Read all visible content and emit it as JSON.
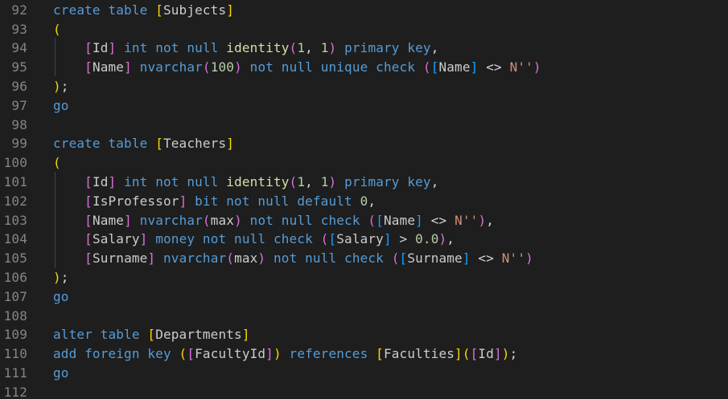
{
  "editor": {
    "colors": {
      "background": "#1e1e1e",
      "line_number": "#858585",
      "keyword": "#569cd6",
      "bracket_gold": "#ffd700",
      "identifier": "#cccccc",
      "function": "#dcdcaa",
      "bracket_purple": "#da70d6",
      "bracket_blue": "#179fff",
      "number": "#b5cea8",
      "string": "#ce9178"
    },
    "lines": [
      {
        "number": "92",
        "tokens": [
          {
            "text": "create table ",
            "kind": "kw"
          },
          {
            "text": "[",
            "kind": "br"
          },
          {
            "text": "Subjects",
            "kind": "id"
          },
          {
            "text": "]",
            "kind": "br"
          }
        ]
      },
      {
        "number": "93",
        "tokens": [
          {
            "text": "(",
            "kind": "br"
          }
        ]
      },
      {
        "number": "94",
        "tokens": [
          {
            "text": "    ",
            "kind": "op"
          },
          {
            "text": "[",
            "kind": "pp"
          },
          {
            "text": "Id",
            "kind": "id"
          },
          {
            "text": "]",
            "kind": "pp"
          },
          {
            "text": " int not null ",
            "kind": "kw"
          },
          {
            "text": "identity",
            "kind": "fn"
          },
          {
            "text": "(",
            "kind": "pp"
          },
          {
            "text": "1",
            "kind": "num"
          },
          {
            "text": ", ",
            "kind": "op"
          },
          {
            "text": "1",
            "kind": "num"
          },
          {
            "text": ")",
            "kind": "pp"
          },
          {
            "text": " primary key",
            "kind": "kw"
          },
          {
            "text": ",",
            "kind": "op"
          }
        ]
      },
      {
        "number": "95",
        "tokens": [
          {
            "text": "    ",
            "kind": "op"
          },
          {
            "text": "[",
            "kind": "pp"
          },
          {
            "text": "Name",
            "kind": "id"
          },
          {
            "text": "]",
            "kind": "pp"
          },
          {
            "text": " nvarchar",
            "kind": "kw"
          },
          {
            "text": "(",
            "kind": "pp"
          },
          {
            "text": "100",
            "kind": "num"
          },
          {
            "text": ")",
            "kind": "pp"
          },
          {
            "text": " not null unique check ",
            "kind": "kw"
          },
          {
            "text": "(",
            "kind": "pp"
          },
          {
            "text": "[",
            "kind": "pb"
          },
          {
            "text": "Name",
            "kind": "id"
          },
          {
            "text": "]",
            "kind": "pb"
          },
          {
            "text": " <> ",
            "kind": "op"
          },
          {
            "text": "N''",
            "kind": "str"
          },
          {
            "text": ")",
            "kind": "pp"
          }
        ]
      },
      {
        "number": "96",
        "tokens": [
          {
            "text": ")",
            "kind": "br"
          },
          {
            "text": ";",
            "kind": "op"
          }
        ]
      },
      {
        "number": "97",
        "tokens": [
          {
            "text": "go",
            "kind": "kw"
          }
        ]
      },
      {
        "number": "98",
        "tokens": []
      },
      {
        "number": "99",
        "tokens": [
          {
            "text": "create table ",
            "kind": "kw"
          },
          {
            "text": "[",
            "kind": "br"
          },
          {
            "text": "Teachers",
            "kind": "id"
          },
          {
            "text": "]",
            "kind": "br"
          }
        ]
      },
      {
        "number": "100",
        "tokens": [
          {
            "text": "(",
            "kind": "br"
          }
        ]
      },
      {
        "number": "101",
        "tokens": [
          {
            "text": "    ",
            "kind": "op"
          },
          {
            "text": "[",
            "kind": "pp"
          },
          {
            "text": "Id",
            "kind": "id"
          },
          {
            "text": "]",
            "kind": "pp"
          },
          {
            "text": " int not null ",
            "kind": "kw"
          },
          {
            "text": "identity",
            "kind": "fn"
          },
          {
            "text": "(",
            "kind": "pp"
          },
          {
            "text": "1",
            "kind": "num"
          },
          {
            "text": ", ",
            "kind": "op"
          },
          {
            "text": "1",
            "kind": "num"
          },
          {
            "text": ")",
            "kind": "pp"
          },
          {
            "text": " primary key",
            "kind": "kw"
          },
          {
            "text": ",",
            "kind": "op"
          }
        ]
      },
      {
        "number": "102",
        "tokens": [
          {
            "text": "    ",
            "kind": "op"
          },
          {
            "text": "[",
            "kind": "pp"
          },
          {
            "text": "IsProfessor",
            "kind": "id"
          },
          {
            "text": "]",
            "kind": "pp"
          },
          {
            "text": " bit not null default ",
            "kind": "kw"
          },
          {
            "text": "0",
            "kind": "num"
          },
          {
            "text": ",",
            "kind": "op"
          }
        ]
      },
      {
        "number": "103",
        "tokens": [
          {
            "text": "    ",
            "kind": "op"
          },
          {
            "text": "[",
            "kind": "pp"
          },
          {
            "text": "Name",
            "kind": "id"
          },
          {
            "text": "]",
            "kind": "pp"
          },
          {
            "text": " nvarchar",
            "kind": "kw"
          },
          {
            "text": "(",
            "kind": "pp"
          },
          {
            "text": "max",
            "kind": "id"
          },
          {
            "text": ")",
            "kind": "pp"
          },
          {
            "text": " not null check ",
            "kind": "kw"
          },
          {
            "text": "(",
            "kind": "pp"
          },
          {
            "text": "[",
            "kind": "pb"
          },
          {
            "text": "Name",
            "kind": "id"
          },
          {
            "text": "]",
            "kind": "pb"
          },
          {
            "text": " <> ",
            "kind": "op"
          },
          {
            "text": "N''",
            "kind": "str"
          },
          {
            "text": ")",
            "kind": "pp"
          },
          {
            "text": ",",
            "kind": "op"
          }
        ]
      },
      {
        "number": "104",
        "tokens": [
          {
            "text": "    ",
            "kind": "op"
          },
          {
            "text": "[",
            "kind": "pp"
          },
          {
            "text": "Salary",
            "kind": "id"
          },
          {
            "text": "]",
            "kind": "pp"
          },
          {
            "text": " money not null check ",
            "kind": "kw"
          },
          {
            "text": "(",
            "kind": "pp"
          },
          {
            "text": "[",
            "kind": "pb"
          },
          {
            "text": "Salary",
            "kind": "id"
          },
          {
            "text": "]",
            "kind": "pb"
          },
          {
            "text": " > ",
            "kind": "op"
          },
          {
            "text": "0.0",
            "kind": "num"
          },
          {
            "text": ")",
            "kind": "pp"
          },
          {
            "text": ",",
            "kind": "op"
          }
        ]
      },
      {
        "number": "105",
        "tokens": [
          {
            "text": "    ",
            "kind": "op"
          },
          {
            "text": "[",
            "kind": "pp"
          },
          {
            "text": "Surname",
            "kind": "id"
          },
          {
            "text": "]",
            "kind": "pp"
          },
          {
            "text": " nvarchar",
            "kind": "kw"
          },
          {
            "text": "(",
            "kind": "pp"
          },
          {
            "text": "max",
            "kind": "id"
          },
          {
            "text": ")",
            "kind": "pp"
          },
          {
            "text": " not null check ",
            "kind": "kw"
          },
          {
            "text": "(",
            "kind": "pp"
          },
          {
            "text": "[",
            "kind": "pb"
          },
          {
            "text": "Surname",
            "kind": "id"
          },
          {
            "text": "]",
            "kind": "pb"
          },
          {
            "text": " <> ",
            "kind": "op"
          },
          {
            "text": "N''",
            "kind": "str"
          },
          {
            "text": ")",
            "kind": "pp"
          }
        ]
      },
      {
        "number": "106",
        "tokens": [
          {
            "text": ")",
            "kind": "br"
          },
          {
            "text": ";",
            "kind": "op"
          }
        ]
      },
      {
        "number": "107",
        "tokens": [
          {
            "text": "go",
            "kind": "kw"
          }
        ]
      },
      {
        "number": "108",
        "tokens": []
      },
      {
        "number": "109",
        "tokens": [
          {
            "text": "alter table ",
            "kind": "kw"
          },
          {
            "text": "[",
            "kind": "br"
          },
          {
            "text": "Departments",
            "kind": "id"
          },
          {
            "text": "]",
            "kind": "br"
          }
        ]
      },
      {
        "number": "110",
        "tokens": [
          {
            "text": "add foreign key ",
            "kind": "kw"
          },
          {
            "text": "(",
            "kind": "br"
          },
          {
            "text": "[",
            "kind": "pp"
          },
          {
            "text": "FacultyId",
            "kind": "id"
          },
          {
            "text": "]",
            "kind": "pp"
          },
          {
            "text": ")",
            "kind": "br"
          },
          {
            "text": " references ",
            "kind": "kw"
          },
          {
            "text": "[",
            "kind": "br"
          },
          {
            "text": "Faculties",
            "kind": "id"
          },
          {
            "text": "]",
            "kind": "br"
          },
          {
            "text": "(",
            "kind": "br"
          },
          {
            "text": "[",
            "kind": "pp"
          },
          {
            "text": "Id",
            "kind": "id"
          },
          {
            "text": "]",
            "kind": "pp"
          },
          {
            "text": ")",
            "kind": "br"
          },
          {
            "text": ";",
            "kind": "op"
          }
        ]
      },
      {
        "number": "111",
        "tokens": [
          {
            "text": "go",
            "kind": "kw"
          }
        ]
      },
      {
        "number": "112",
        "tokens": []
      }
    ]
  }
}
